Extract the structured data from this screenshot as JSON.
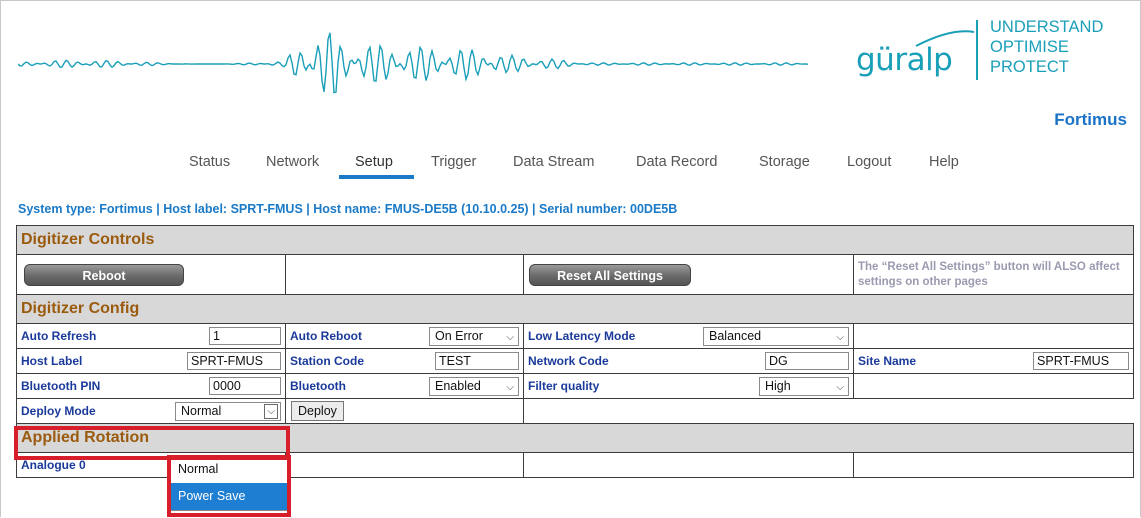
{
  "header": {
    "logo": "güralp",
    "tagline": [
      "UNDERSTAND",
      "OPTIMISE",
      "PROTECT"
    ],
    "product_name": "Fortimus"
  },
  "nav": {
    "items": [
      "Status",
      "Network",
      "Setup",
      "Trigger",
      "Data Stream",
      "Data Record",
      "Storage",
      "Logout",
      "Help"
    ],
    "active": "Setup"
  },
  "system_line": "System type: Fortimus | Host label: SPRT-FMUS | Host name: FMUS-DE5B (10.10.0.25) | Serial number: 00DE5B",
  "digitizer_controls": {
    "title": "Digitizer Controls",
    "reboot_label": "Reboot",
    "reset_label": "Reset All Settings",
    "note": "The “Reset All Settings” button will ALSO affect settings on other pages"
  },
  "digitizer_config": {
    "title": "Digitizer Config",
    "auto_refresh": {
      "label": "Auto Refresh",
      "value": "1"
    },
    "auto_reboot": {
      "label": "Auto Reboot",
      "value": "On Error"
    },
    "low_latency": {
      "label": "Low Latency Mode",
      "value": "Balanced"
    },
    "host_label": {
      "label": "Host Label",
      "value": "SPRT-FMUS"
    },
    "station_code": {
      "label": "Station Code",
      "value": "TEST"
    },
    "network_code": {
      "label": "Network Code",
      "value": "DG"
    },
    "site_name": {
      "label": "Site Name",
      "value": "SPRT-FMUS"
    },
    "bluetooth_pin": {
      "label": "Bluetooth PIN",
      "value": "0000"
    },
    "bluetooth": {
      "label": "Bluetooth",
      "value": "Enabled"
    },
    "filter_quality": {
      "label": "Filter quality",
      "value": "High"
    },
    "deploy_mode": {
      "label": "Deploy Mode",
      "value": "Normal",
      "options": [
        "Normal",
        "Power Save"
      ],
      "highlighted": "Power Save"
    },
    "deploy_button": "Deploy"
  },
  "applied_rotation": {
    "title": "Applied Rotation",
    "row_label": "Analogue 0"
  },
  "colors": {
    "brand": "#1a9fb9",
    "link_blue": "#1a7ac8",
    "section_title": "#9b5b0e",
    "highlight": "#d81e2a"
  }
}
